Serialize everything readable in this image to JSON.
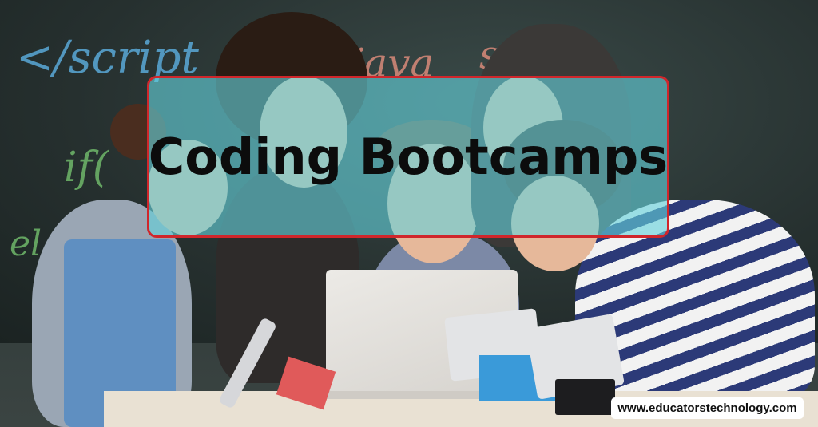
{
  "banner": {
    "title": "Coding Bootcamps",
    "watermark": "www.educatorstechnology.com"
  },
  "chalkboard": {
    "snippets": [
      "</script",
      "java",
      "script",
      "if(",
      "el"
    ]
  },
  "colors": {
    "title_box_fill": "#64d2dc",
    "title_box_border": "#d0262b",
    "title_text": "#0c0c0c",
    "watermark_bg": "#ffffff"
  }
}
